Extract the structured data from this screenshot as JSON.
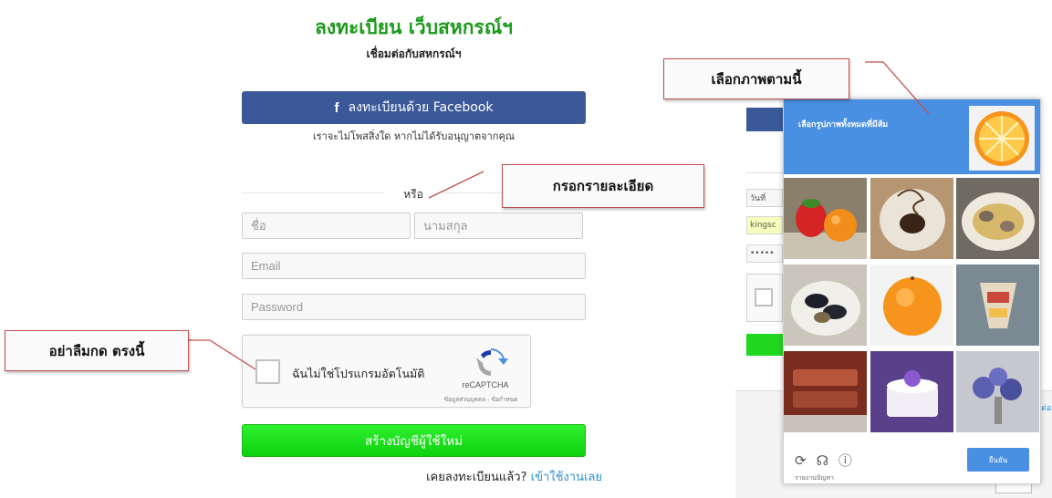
{
  "form": {
    "title": "ลงทะเบียน เว็บสหกรณ์ฯ",
    "subtitle": "เชื่อมต่อกับสหกรณ์ฯ",
    "facebook_label": "ลงทะเบียนด้วย Facebook",
    "facebook_icon": "f",
    "facebook_note": "เราจะไม่โพสสิ่งใด หากไม่ได้รับอนุญาตจากคุณ",
    "or_text": "หรือ",
    "first_name_placeholder": "ชื่อ",
    "last_name_placeholder": "นามสกุล",
    "email_placeholder": "Email",
    "password_placeholder": "Password",
    "recaptcha_label": "ฉันไม่ใช่โปรแกรมอัตโนมัติ",
    "recaptcha_brand": "reCAPTCHA",
    "recaptcha_links": "ข้อมูลส่วนบุคคล - ข้อกำหนด",
    "submit_label": "สร้างบัญชีผู้ใช้ใหม่",
    "login_prompt": "เคยลงทะเบียนแล้ว?",
    "login_link": "เข้าใช้งานเลย"
  },
  "callouts": {
    "fill_details": "กรอกรายละเอียด",
    "press_here": "อย่าลืมกด ตรงนี้",
    "select_images": "เลือกภาพตามนี้"
  },
  "background_page": {
    "date_field": "วันที่",
    "user_field": "kingsc",
    "password_mask": "•••••",
    "edge_text": "ต่อ"
  },
  "challenge": {
    "instruction": "เลือกรูปภาพทั้งหมดที่มีส้ม",
    "verify_label": "ยืนยัน",
    "report_label": "รายงานปัญหา",
    "tools": [
      "reload-icon",
      "headphones-icon",
      "info-icon"
    ],
    "tiles": [
      "strawberries-and-orange",
      "chocolate-dessert",
      "clam-pasta",
      "mussels-dish",
      "orange",
      "parfait-dessert",
      "grilled-meat",
      "purple-cake",
      "flower-centerpiece"
    ]
  },
  "colors": {
    "title_green": "#1a9a1a",
    "facebook_blue": "#3b5998",
    "submit_green": "#18d918",
    "link_blue": "#2a8fd6",
    "callout_border": "#c0504d",
    "recaptcha_blue": "#4a90e2"
  }
}
